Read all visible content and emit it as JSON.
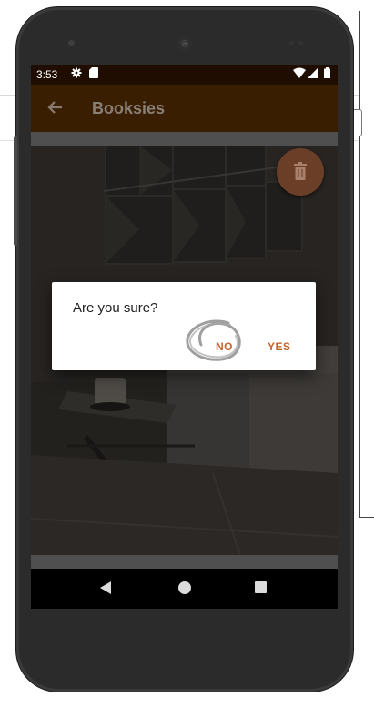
{
  "status_bar": {
    "time": "3:53",
    "icons": [
      "gear-icon",
      "sd-card-icon",
      "wifi-icon",
      "signal-icon",
      "battery-icon"
    ]
  },
  "app_bar": {
    "back_icon": "arrow-left-icon",
    "title": "Booksies"
  },
  "fab": {
    "icon": "trash-icon"
  },
  "dialog": {
    "message": "Are you sure?",
    "no_label": "NO",
    "yes_label": "YES",
    "accent_color": "#c7642d"
  },
  "nav_bar": {
    "icons": [
      "back-triangle-icon",
      "home-circle-icon",
      "recents-square-icon"
    ]
  },
  "colors": {
    "status_bar": "#1e0d00",
    "app_bar": "#3a1e02",
    "fab": "#6b3f27"
  }
}
